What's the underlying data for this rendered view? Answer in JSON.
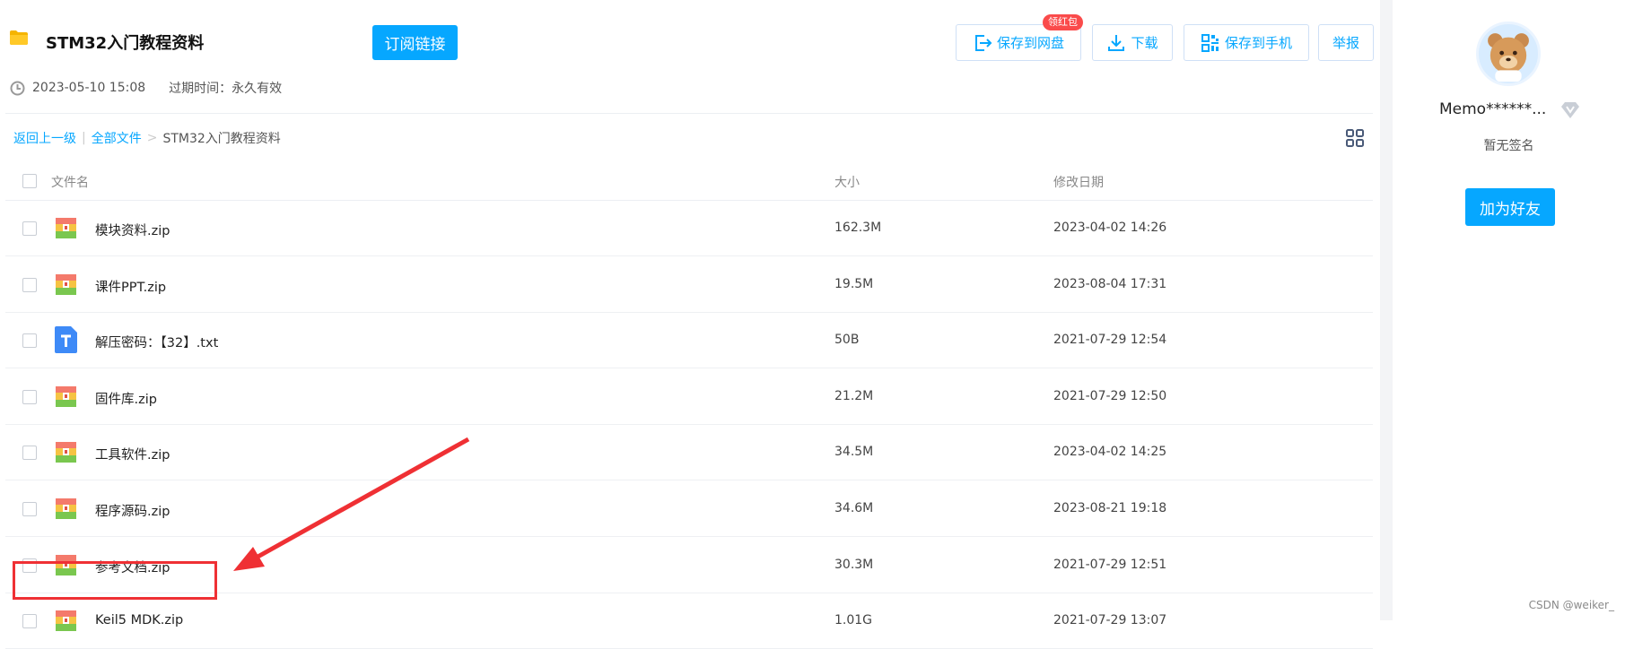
{
  "share": {
    "title": "STM32入门教程资料",
    "subscribe_label": "订阅链接",
    "created": "2023-05-10 15:08",
    "expire_label": "过期时间：",
    "expire_value": "永久有效"
  },
  "toolbar": {
    "save_cloud": "保存到网盘",
    "badge": "领红包",
    "download": "下载",
    "save_phone": "保存到手机",
    "report": "举报"
  },
  "breadcrumb": {
    "back": "返回上一级",
    "sep1": "|",
    "all": "全部文件",
    "sep2": ">",
    "current": "STM32入门教程资料"
  },
  "table": {
    "col_name": "文件名",
    "col_size": "大小",
    "col_date": "修改日期",
    "rows": [
      {
        "name": "模块资料.zip",
        "size": "162.3M",
        "date": "2023-04-02 14:26",
        "type": "zip"
      },
      {
        "name": "课件PPT.zip",
        "size": "19.5M",
        "date": "2023-08-04 17:31",
        "type": "zip"
      },
      {
        "name": "解压密码：【32】.txt",
        "size": "50B",
        "date": "2021-07-29 12:54",
        "type": "txt"
      },
      {
        "name": "固件库.zip",
        "size": "21.2M",
        "date": "2021-07-29 12:50",
        "type": "zip"
      },
      {
        "name": "工具软件.zip",
        "size": "34.5M",
        "date": "2023-04-02 14:25",
        "type": "zip"
      },
      {
        "name": "程序源码.zip",
        "size": "34.6M",
        "date": "2023-08-21 19:18",
        "type": "zip"
      },
      {
        "name": "参考文档.zip",
        "size": "30.3M",
        "date": "2021-07-29 12:51",
        "type": "zip"
      },
      {
        "name": "Keil5 MDK.zip",
        "size": "1.01G",
        "date": "2021-07-29 13:07",
        "type": "zip"
      }
    ]
  },
  "user": {
    "name": "Memo******...",
    "signature": "暂无签名",
    "add_friend": "加为好友"
  },
  "watermark": "CSDN @weiker_",
  "colors": {
    "accent": "#06a7ff",
    "badge": "#fa4b4b",
    "annotation": "#ef3034"
  },
  "icons": [
    "folder-icon",
    "clock-icon",
    "save-to-cloud-icon",
    "download-icon",
    "qr-phone-icon",
    "grid-view-icon",
    "zip-file-icon",
    "txt-file-icon",
    "vip-diamond-icon"
  ]
}
